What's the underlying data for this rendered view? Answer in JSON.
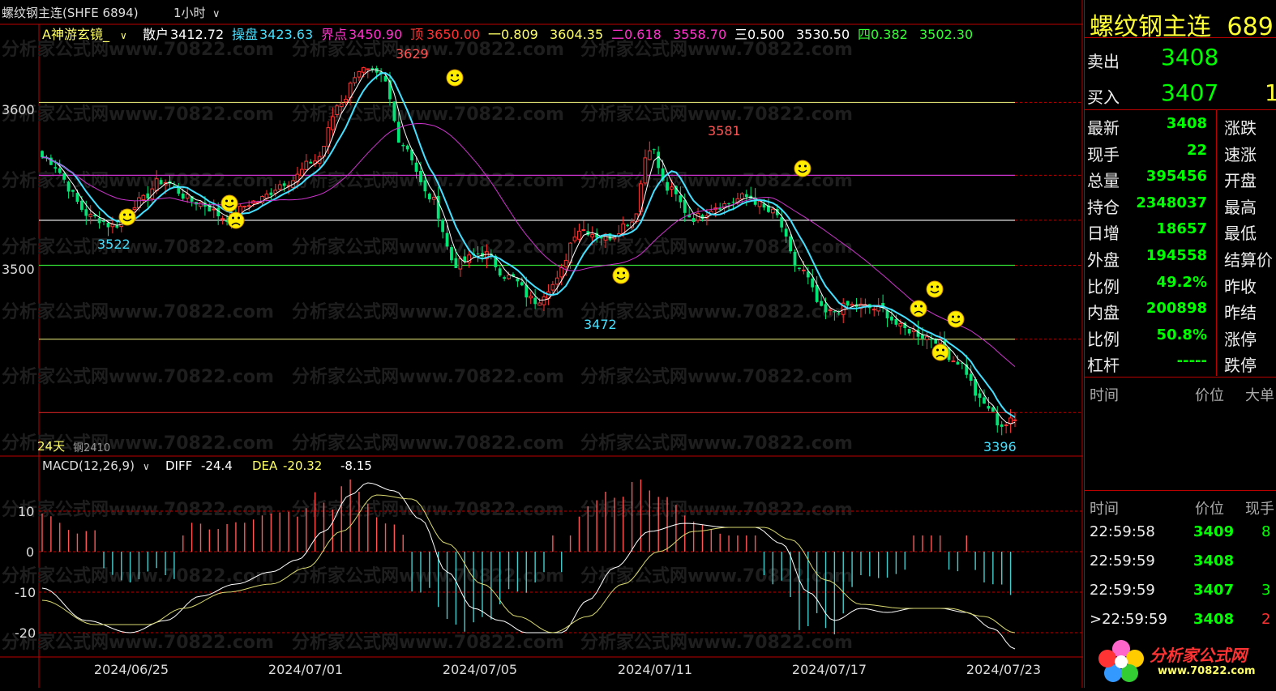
{
  "header": {
    "title": "螺纹钢主连(SHFE 6894)",
    "period": "1小时",
    "indicator_name": "A神游玄镜_",
    "levels": [
      {
        "label": "散户",
        "value": "3412.72",
        "label_color": "#ffffff",
        "value_color": "#ffffff"
      },
      {
        "label": "操盘",
        "value": "3423.63",
        "label_color": "#44e0ff",
        "value_color": "#44e0ff"
      },
      {
        "label": "界点",
        "value": "3450.90",
        "label_color": "#ff33cc",
        "value_color": "#ff33cc"
      },
      {
        "label": "顶",
        "value": "3650.00",
        "label_color": "#ff3333",
        "value_color": "#ff3333"
      },
      {
        "label": "一0.809",
        "value": "3604.35",
        "label_color": "#ffff66",
        "value_color": "#ffff66"
      },
      {
        "label": "二0.618",
        "value": "3558.70",
        "label_color": "#ff33cc",
        "value_color": "#ff33cc"
      },
      {
        "label": "三0.500",
        "value": "3530.50",
        "label_color": "#ffffff",
        "value_color": "#ffffff"
      },
      {
        "label": "四0.382",
        "value": "3502.30",
        "label_color": "#33ff33",
        "value_color": "#33ff33"
      }
    ],
    "bottom_note": "24天",
    "bottom_contract": "钢2410"
  },
  "watermark": "分析家公式网www.70822.com",
  "chart_data": [
    {
      "type": "candlestick",
      "y_ticks": [
        3500,
        3600
      ],
      "ylim": [
        3390,
        3660
      ],
      "x_ticks": [
        "2024/06/25",
        "2024/07/01",
        "2024/07/05",
        "2024/07/11",
        "2024/07/17",
        "2024/07/23"
      ],
      "horizontal_levels": [
        {
          "value": 3604.35,
          "color": "#d8d870"
        },
        {
          "value": 3558.7,
          "color": "#cc33cc"
        },
        {
          "value": 3530.5,
          "color": "#ffffff"
        },
        {
          "value": 3502.3,
          "color": "#33dd33"
        },
        {
          "value": 3456.0,
          "color": "#d8d870"
        },
        {
          "value": 3410.0,
          "color": "#cc2222"
        }
      ],
      "annotations": [
        {
          "text": "3629",
          "color": "#ff5555"
        },
        {
          "text": "3581",
          "color": "#ff5555"
        },
        {
          "text": "3522",
          "color": "#44e0ff"
        },
        {
          "text": "3472",
          "color": "#44e0ff"
        },
        {
          "text": "3396",
          "color": "#44e0ff"
        }
      ],
      "keypoints": [
        [
          0,
          3570
        ],
        [
          12,
          3532
        ],
        [
          16,
          3527
        ],
        [
          22,
          3542
        ],
        [
          27,
          3555
        ],
        [
          35,
          3542
        ],
        [
          42,
          3532
        ],
        [
          48,
          3542
        ],
        [
          56,
          3555
        ],
        [
          62,
          3568
        ],
        [
          68,
          3605
        ],
        [
          72,
          3625
        ],
        [
          77,
          3620
        ],
        [
          82,
          3578
        ],
        [
          88,
          3545
        ],
        [
          94,
          3503
        ],
        [
          100,
          3510
        ],
        [
          106,
          3495
        ],
        [
          112,
          3480
        ],
        [
          116,
          3490
        ],
        [
          122,
          3525
        ],
        [
          128,
          3520
        ],
        [
          134,
          3530
        ],
        [
          138,
          3577
        ],
        [
          142,
          3550
        ],
        [
          148,
          3532
        ],
        [
          154,
          3540
        ],
        [
          160,
          3545
        ],
        [
          166,
          3535
        ],
        [
          172,
          3500
        ],
        [
          178,
          3472
        ],
        [
          184,
          3477
        ],
        [
          190,
          3475
        ],
        [
          196,
          3462
        ],
        [
          202,
          3457
        ],
        [
          208,
          3442
        ],
        [
          214,
          3415
        ],
        [
          218,
          3402
        ],
        [
          221,
          3405
        ]
      ]
    },
    {
      "type": "macd",
      "title": "MACD(12,26,9)",
      "diff": -24.4,
      "dea": -20.32,
      "macd": -8.15,
      "y_ticks": [
        10,
        0,
        -10,
        -20
      ],
      "ylim": [
        -25,
        18
      ],
      "diff_keypoints": [
        [
          0,
          -9
        ],
        [
          10,
          -17
        ],
        [
          20,
          -20
        ],
        [
          28,
          -17
        ],
        [
          36,
          -11
        ],
        [
          44,
          -8
        ],
        [
          52,
          -5
        ],
        [
          58,
          -2
        ],
        [
          64,
          5
        ],
        [
          70,
          14
        ],
        [
          74,
          17
        ],
        [
          80,
          15
        ],
        [
          86,
          8
        ],
        [
          92,
          -5
        ],
        [
          98,
          -14
        ],
        [
          104,
          -17
        ],
        [
          110,
          -20
        ],
        [
          118,
          -20
        ],
        [
          124,
          -12
        ],
        [
          130,
          -4
        ],
        [
          138,
          5
        ],
        [
          146,
          7
        ],
        [
          156,
          6
        ],
        [
          162,
          6
        ],
        [
          168,
          2
        ],
        [
          174,
          -10
        ],
        [
          180,
          -17
        ],
        [
          186,
          -14
        ],
        [
          192,
          -15
        ],
        [
          198,
          -14
        ],
        [
          204,
          -14
        ],
        [
          210,
          -15
        ],
        [
          216,
          -19
        ],
        [
          221,
          -24
        ]
      ],
      "dea_keypoints": [
        [
          0,
          -12
        ],
        [
          12,
          -18
        ],
        [
          24,
          -18
        ],
        [
          32,
          -14
        ],
        [
          42,
          -10
        ],
        [
          52,
          -8
        ],
        [
          60,
          -4
        ],
        [
          68,
          5
        ],
        [
          76,
          14
        ],
        [
          84,
          13
        ],
        [
          92,
          2
        ],
        [
          100,
          -8
        ],
        [
          108,
          -16
        ],
        [
          116,
          -20
        ],
        [
          124,
          -16
        ],
        [
          132,
          -8
        ],
        [
          140,
          0
        ],
        [
          148,
          5
        ],
        [
          156,
          6
        ],
        [
          164,
          6
        ],
        [
          170,
          3
        ],
        [
          178,
          -7
        ],
        [
          186,
          -13
        ],
        [
          196,
          -14
        ],
        [
          206,
          -14
        ],
        [
          214,
          -16
        ],
        [
          221,
          -20
        ]
      ]
    }
  ],
  "quote": {
    "title": "螺纹钢主连",
    "code": "689",
    "sell_label": "卖出",
    "sell_price": "3408",
    "buy_label": "买入",
    "buy_price": "3407",
    "buy_qty": "1",
    "rows": [
      {
        "label": "最新",
        "value": "3408",
        "label2": "涨跌"
      },
      {
        "label": "现手",
        "value": "22",
        "label2": "速涨"
      },
      {
        "label": "总量",
        "value": "395456",
        "label2": "开盘"
      },
      {
        "label": "持仓",
        "value": "2348037",
        "label2": "最高"
      },
      {
        "label": "日增",
        "value": "18657",
        "label2": "最低"
      },
      {
        "label": "外盘",
        "value": "194558",
        "label2": "结算价"
      },
      {
        "label": "比例",
        "value": "49.2%",
        "label2": "昨收"
      },
      {
        "label": "内盘",
        "value": "200898",
        "label2": "昨结"
      },
      {
        "label": "比例",
        "value": "50.8%",
        "label2": "涨停"
      },
      {
        "label": "杠杆",
        "value": "-----",
        "label2": "跌停"
      }
    ],
    "tick_header1": {
      "time": "时间",
      "price": "价位",
      "extra": "大单"
    },
    "tick_header2": {
      "time": "时间",
      "price": "价位",
      "extra": "现手"
    },
    "ticks": [
      {
        "time": "22:59:58",
        "price": "3409",
        "qty": "8"
      },
      {
        "time": "22:59:59",
        "price": "3408",
        "qty": ""
      },
      {
        "time": "22:59:59",
        "price": "3407",
        "qty": "3"
      },
      {
        "time": ">22:59:59",
        "price": "3408",
        "qty": "2"
      }
    ],
    "logo_text": "分析家公式网",
    "logo_url": "www.70822.com"
  }
}
